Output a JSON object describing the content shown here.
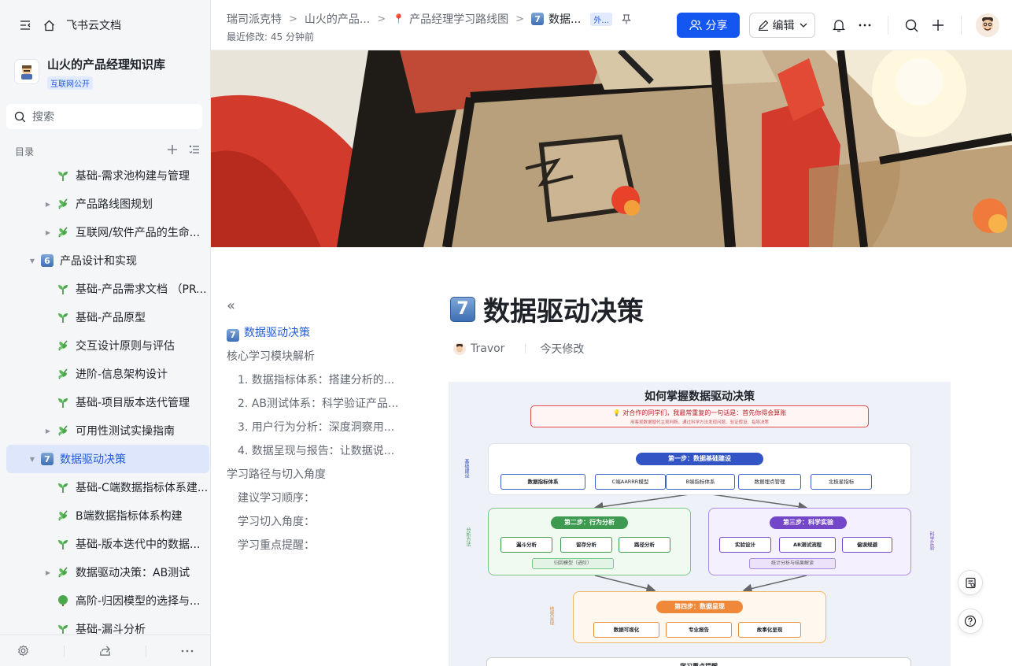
{
  "app": {
    "title": "飞书云文档"
  },
  "kb": {
    "title": "山火的产品经理知识库",
    "badge": "互联网公开"
  },
  "search": {
    "placeholder": "搜索"
  },
  "toc": {
    "label": "目录"
  },
  "tree": [
    {
      "label": "基础-需求池构建与管理",
      "icon": "sprout",
      "expand": "",
      "indent": 1
    },
    {
      "label": "产品路线图规划",
      "icon": "herb",
      "expand": "▶",
      "indent": 1
    },
    {
      "label": "互联网/软件产品的生命...",
      "icon": "herb",
      "expand": "▶",
      "indent": 1
    },
    {
      "label": "产品设计和实现",
      "icon": "num6",
      "expand": "▼",
      "indent": 0
    },
    {
      "label": "基础-产品需求文档 （PR...",
      "icon": "sprout",
      "expand": "",
      "indent": 1
    },
    {
      "label": "基础-产品原型",
      "icon": "sprout",
      "expand": "",
      "indent": 1
    },
    {
      "label": "交互设计原则与评估",
      "icon": "herb",
      "expand": "",
      "indent": 1
    },
    {
      "label": "进阶-信息架构设计",
      "icon": "herb",
      "expand": "",
      "indent": 1
    },
    {
      "label": "基础-项目版本迭代管理",
      "icon": "sprout",
      "expand": "",
      "indent": 1
    },
    {
      "label": "可用性测试实操指南",
      "icon": "herb",
      "expand": "▶",
      "indent": 1
    },
    {
      "label": "数据驱动决策",
      "icon": "num7",
      "expand": "▼",
      "indent": 0,
      "active": true
    },
    {
      "label": "基础-C端数据指标体系建...",
      "icon": "sprout",
      "expand": "",
      "indent": 1
    },
    {
      "label": "B端数据指标体系构建",
      "icon": "herb",
      "expand": "",
      "indent": 1
    },
    {
      "label": "基础-版本迭代中的数据...",
      "icon": "sprout",
      "expand": "",
      "indent": 1
    },
    {
      "label": "数据驱动决策：AB测试",
      "icon": "herb",
      "expand": "▶",
      "indent": 1
    },
    {
      "label": "高阶-归因模型的选择与...",
      "icon": "tree",
      "expand": "",
      "indent": 1
    },
    {
      "label": "基础-漏斗分析",
      "icon": "sprout",
      "expand": "",
      "indent": 1
    }
  ],
  "header": {
    "crumbs": [
      "瑞司派克特",
      "山火的产品...",
      "产品经理学习路线图",
      "数据..."
    ],
    "badge": "外...",
    "modified": "最近修改: 45 分钟前",
    "share": "分享",
    "edit": "编辑"
  },
  "outline": {
    "items": [
      {
        "label": "数据驱动决策",
        "level": 1,
        "active": true
      },
      {
        "label": "核心学习模块解析",
        "level": 1
      },
      {
        "label": "1. 数据指标体系：搭建分析的...",
        "level": 2
      },
      {
        "label": "2. AB测试体系：科学验证产品...",
        "level": 2
      },
      {
        "label": "3. 用户行为分析：深度洞察用...",
        "level": 2
      },
      {
        "label": "4. 数据呈现与报告：让数据说...",
        "level": 2
      },
      {
        "label": "学习路径与切入角度",
        "level": 1
      },
      {
        "label": "建议学习顺序：",
        "level": 2
      },
      {
        "label": "学习切入角度：",
        "level": 2
      },
      {
        "label": "学习重点提醒：",
        "level": 2
      }
    ]
  },
  "doc": {
    "number": "7",
    "title": "数据驱动决策",
    "author": "Travor",
    "modified": "今天修改"
  },
  "diagram": {
    "title": "如何掌握数据驱动决策",
    "tip": "💡 对合作的同学们，我最常重复的一句话是：首先你得会算账",
    "tip_sub": "用客观数据替代主观判断，通过科学方法发现问题、验证假设、指导决策",
    "step1": {
      "title": "第一步：数据基础建设",
      "items": [
        "数据指标体系",
        "C端AARRR模型",
        "B端指标体系",
        "数据埋点管理",
        "北极星指标"
      ],
      "side": "基础建设"
    },
    "step2": {
      "title": "第二步：行为分析",
      "items": [
        "漏斗分析",
        "留存分析",
        "路径分析"
      ],
      "sub": "归因模型（进阶）",
      "side": "分析方法"
    },
    "step3": {
      "title": "第三步：科学实验",
      "items": [
        "实验设计",
        "AB测试流程",
        "偏误规避"
      ],
      "sub": "统计分析与结果解读",
      "side": "科学实验"
    },
    "step4": {
      "title": "第四步：数据呈现",
      "items": [
        "数据可视化",
        "专业报告",
        "故事化呈现"
      ],
      "side": "结果呈现"
    },
    "bottom": "学习重点提醒"
  },
  "colors": {
    "accent": "#1456f0",
    "active_bg": "#dde6fb",
    "link": "#245bdb"
  }
}
